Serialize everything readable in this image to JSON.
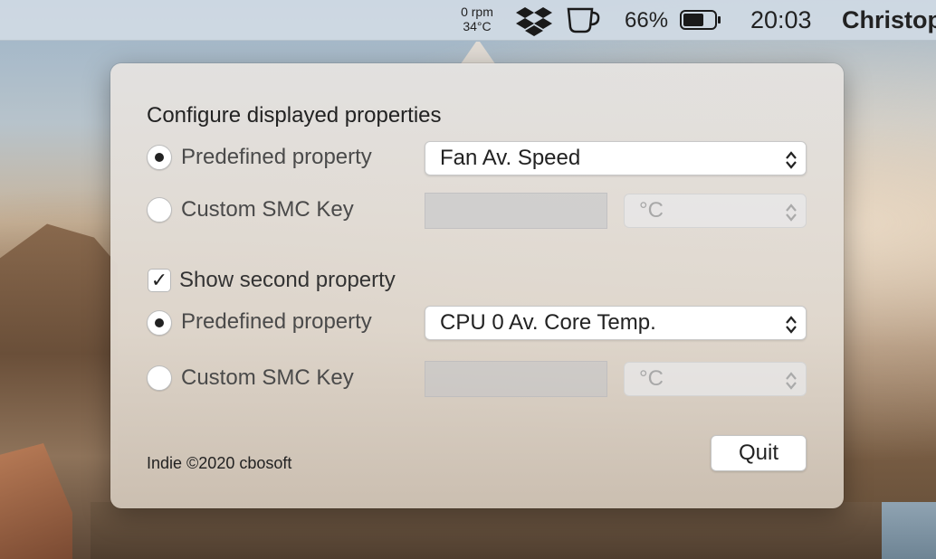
{
  "menubar": {
    "fan_speed": "0 rpm",
    "temperature": "34°C",
    "icons": [
      "dropbox-icon",
      "coffee-cup-icon",
      "battery-icon"
    ],
    "battery_percent": "66%",
    "battery_level": 0.66,
    "clock": "20:03",
    "user": "Christop"
  },
  "popover": {
    "heading": "Configure displayed properties",
    "first": {
      "predefined_label": "Predefined property",
      "predefined_selected": true,
      "predefined_value": "Fan Av. Speed",
      "custom_label": "Custom SMC Key",
      "custom_value": "",
      "custom_unit": "°C"
    },
    "second": {
      "show_label": "Show second property",
      "show_checked": true,
      "predefined_label": "Predefined property",
      "predefined_selected": true,
      "predefined_value": "CPU 0 Av. Core Temp.",
      "custom_label": "Custom SMC Key",
      "custom_value": "",
      "custom_unit": "°C"
    },
    "footer": "Indie ©2020 cbosoft",
    "quit_label": "Quit"
  },
  "colors": {
    "menubar_bg": "#d0dae4",
    "popover_bg": "#e2ddd6",
    "text": "#222222"
  }
}
